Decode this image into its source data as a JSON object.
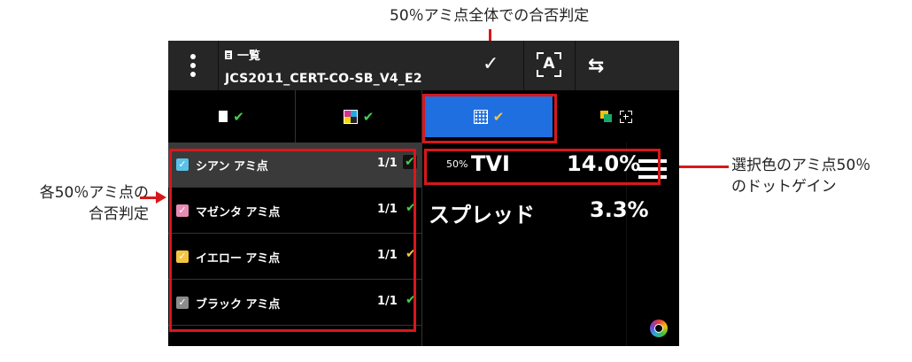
{
  "annotations": {
    "top": "50％アミ点全体での合否判定",
    "left_line1": "各50％アミ点の",
    "left_line2": "合否判定",
    "right_line1": "選択色のアミ点50％",
    "right_line2": "のドットゲイン"
  },
  "header": {
    "view_label": "一覧",
    "file_name": "JCS2011_CERT-CO-SB_V4_E2",
    "check_glyph": "✓",
    "ocr_glyph": "A",
    "swap_glyph": "⇆"
  },
  "tabs": [
    {
      "id": "document",
      "check": "✔",
      "check_color": "#3fd34a"
    },
    {
      "id": "cmyk",
      "check": "✔",
      "check_color": "#3fd34a"
    },
    {
      "id": "halftone",
      "check": "✔",
      "check_color": "#f5c542",
      "active": true
    },
    {
      "id": "overlap"
    }
  ],
  "items": [
    {
      "name": "シアン アミ点",
      "count": "1/1",
      "check": "✔",
      "check_color": "#3fd34a",
      "checkbox_color": "#5bc0e8",
      "selected": true
    },
    {
      "name": "マゼンタ アミ点",
      "count": "1/1",
      "check": "✔",
      "check_color": "#3fd34a",
      "checkbox_color": "#e88cb4"
    },
    {
      "name": "イエロー アミ点",
      "count": "1/1",
      "check": "✔",
      "check_color": "#f5c542",
      "checkbox_color": "#f5c542"
    },
    {
      "name": "ブラック アミ点",
      "count": "1/1",
      "check": "✔",
      "check_color": "#3fd34a",
      "checkbox_color": "#8c8c8c"
    }
  ],
  "metrics": {
    "tvi_percent": "50%",
    "tvi_label": "TVI",
    "tvi_value": "14.0%",
    "spread_label": "スプレッド",
    "spread_value": "3.3%"
  },
  "colors": {
    "accent_tab": "#1f6fe0",
    "highlight": "#d8171b"
  }
}
